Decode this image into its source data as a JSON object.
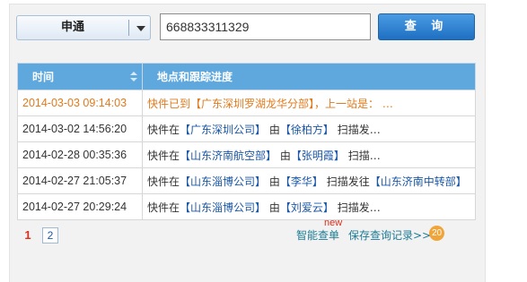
{
  "search": {
    "carrier": "申通",
    "tracking_number": "668833311329",
    "query_label": "查 询"
  },
  "table": {
    "headers": {
      "time": "时间",
      "progress": "地点和跟踪进度"
    },
    "rows": [
      {
        "time": "2014-03-03 09:14:03",
        "pre": "快件已到",
        "loc1": "【广东深圳罗湖龙华分部】",
        "mid": "，上一站是：",
        "loc2": "",
        "post": " …",
        "highlight": true
      },
      {
        "time": "2014-03-02 14:56:20",
        "pre": "快件在",
        "loc1": "【广东深圳公司】",
        "mid": " 由",
        "loc2": "【徐柏方】",
        "post": " 扫描发…"
      },
      {
        "time": "2014-02-28 00:35:36",
        "pre": "快件在",
        "loc1": "【山东济南航空部】",
        "mid": " 由",
        "loc2": "【张明霞】",
        "post": " 扫描…"
      },
      {
        "time": "2014-02-27 21:05:37",
        "pre": "快件在",
        "loc1": "【山东淄博公司】",
        "mid": " 由",
        "loc2": "【李华】",
        "post": " 扫描发往",
        "loc3": "【山东济南中转部】"
      },
      {
        "time": "2014-02-27 20:29:24",
        "pre": "快件在",
        "loc1": "【山东淄博公司】",
        "mid": " 由",
        "loc2": "【刘爱云】",
        "post": " 扫描发…"
      }
    ]
  },
  "pagination": {
    "current": "1",
    "next": "2"
  },
  "footer": {
    "smart_query": "智能查单",
    "new_badge": "new",
    "saved_records": "保存查询记录>>",
    "saved_count": "20"
  },
  "colors": {
    "header_bg": "#5ea8de",
    "button_bg": "#1f6fc2",
    "highlight_text": "#e07a1c",
    "location_text": "#1a57a8",
    "badge": "#f0a53a"
  }
}
